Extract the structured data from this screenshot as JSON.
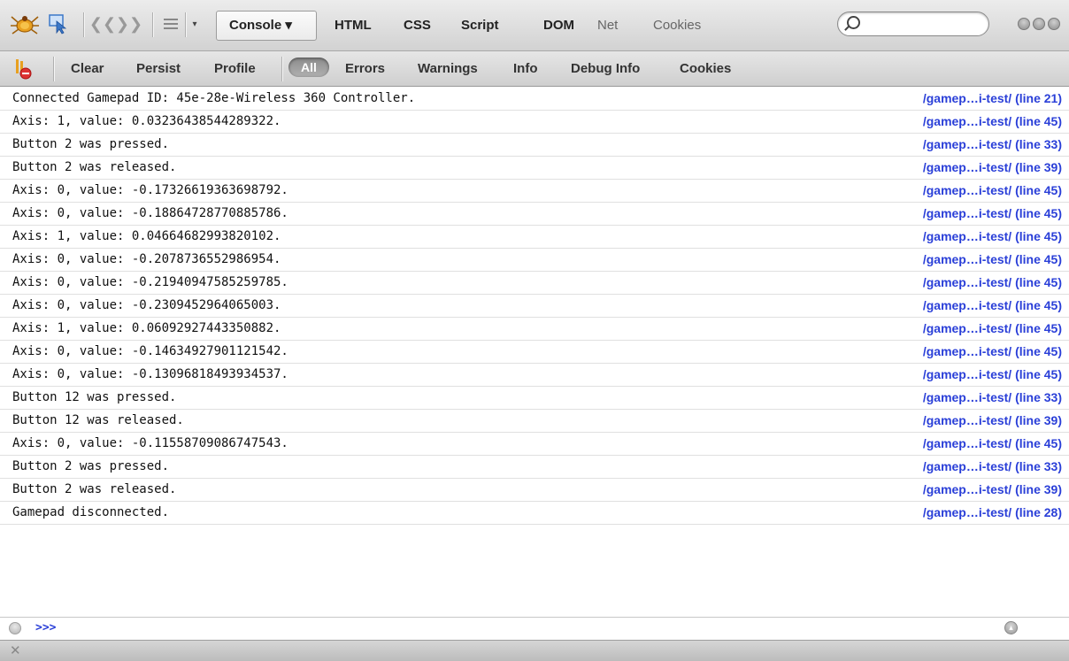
{
  "toolbar": {
    "tabs": [
      {
        "label": "Console ▾",
        "active": true
      },
      {
        "label": "HTML"
      },
      {
        "label": "CSS"
      },
      {
        "label": "Script"
      },
      {
        "label": "DOM"
      },
      {
        "label": "Net"
      },
      {
        "label": "Cookies"
      }
    ],
    "search": {
      "value": "",
      "placeholder": ""
    }
  },
  "filters": {
    "clear": "Clear",
    "persist": "Persist",
    "profile": "Profile",
    "all": "All",
    "errors": "Errors",
    "warnings": "Warnings",
    "info": "Info",
    "debug_info": "Debug Info",
    "cookies": "Cookies"
  },
  "log": [
    {
      "msg": "Connected Gamepad ID: 45e-28e-Wireless 360 Controller.",
      "src": "/gamep…i-test/ (line 21)"
    },
    {
      "msg": "Axis: 1, value: 0.03236438544289322.",
      "src": "/gamep…i-test/ (line 45)"
    },
    {
      "msg": "Button 2 was pressed.",
      "src": "/gamep…i-test/ (line 33)"
    },
    {
      "msg": "Button 2 was released.",
      "src": "/gamep…i-test/ (line 39)"
    },
    {
      "msg": "Axis: 0, value: -0.17326619363698792.",
      "src": "/gamep…i-test/ (line 45)"
    },
    {
      "msg": "Axis: 0, value: -0.18864728770885786.",
      "src": "/gamep…i-test/ (line 45)"
    },
    {
      "msg": "Axis: 1, value: 0.04664682993820102.",
      "src": "/gamep…i-test/ (line 45)"
    },
    {
      "msg": "Axis: 0, value: -0.2078736552986954.",
      "src": "/gamep…i-test/ (line 45)"
    },
    {
      "msg": "Axis: 0, value: -0.21940947585259785.",
      "src": "/gamep…i-test/ (line 45)"
    },
    {
      "msg": "Axis: 0, value: -0.2309452964065003.",
      "src": "/gamep…i-test/ (line 45)"
    },
    {
      "msg": "Axis: 1, value: 0.06092927443350882.",
      "src": "/gamep…i-test/ (line 45)"
    },
    {
      "msg": "Axis: 0, value: -0.14634927901121542.",
      "src": "/gamep…i-test/ (line 45)"
    },
    {
      "msg": "Axis: 0, value: -0.13096818493934537.",
      "src": "/gamep…i-test/ (line 45)"
    },
    {
      "msg": "Button 12 was pressed.",
      "src": "/gamep…i-test/ (line 33)"
    },
    {
      "msg": "Button 12 was released.",
      "src": "/gamep…i-test/ (line 39)"
    },
    {
      "msg": "Axis: 0, value: -0.11558709086747543.",
      "src": "/gamep…i-test/ (line 45)"
    },
    {
      "msg": "Button 2 was pressed.",
      "src": "/gamep…i-test/ (line 33)"
    },
    {
      "msg": "Button 2 was released.",
      "src": "/gamep…i-test/ (line 39)"
    },
    {
      "msg": "Gamepad disconnected.",
      "src": "/gamep…i-test/ (line 28)"
    }
  ],
  "command_line": {
    "prompt": ">>>",
    "value": ""
  },
  "icons": {
    "firebug": "firebug-icon",
    "inspect": "inspect-icon",
    "back": "back-icon",
    "forward": "forward-icon",
    "list": "list-icon",
    "dropdown": "dropdown-icon",
    "clear_console": "clear-console-icon",
    "close": "close-icon"
  },
  "colors": {
    "link": "#2a3fd8",
    "prompt": "#2a3fd8"
  }
}
